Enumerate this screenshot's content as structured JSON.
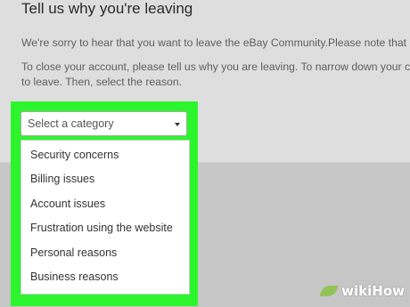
{
  "page": {
    "heading": "Tell us why you're leaving",
    "paragraph1": "We're sorry to hear that you want to leave the eBay Community.Please note that",
    "paragraph2_line1": "To close your account, please tell us why you are leaving. To narrow down your c",
    "paragraph2_line2": "to leave. Then, select the reason."
  },
  "category_select": {
    "selected": "Select a category",
    "icon": "chevron-down-icon",
    "options": [
      "Security concerns",
      "Billing issues",
      "Account issues",
      "Frustration using the website",
      "Personal reasons",
      "Business reasons"
    ]
  },
  "highlight_color": "#2df52d",
  "watermark": {
    "wiki": "wiki",
    "how": "How"
  }
}
